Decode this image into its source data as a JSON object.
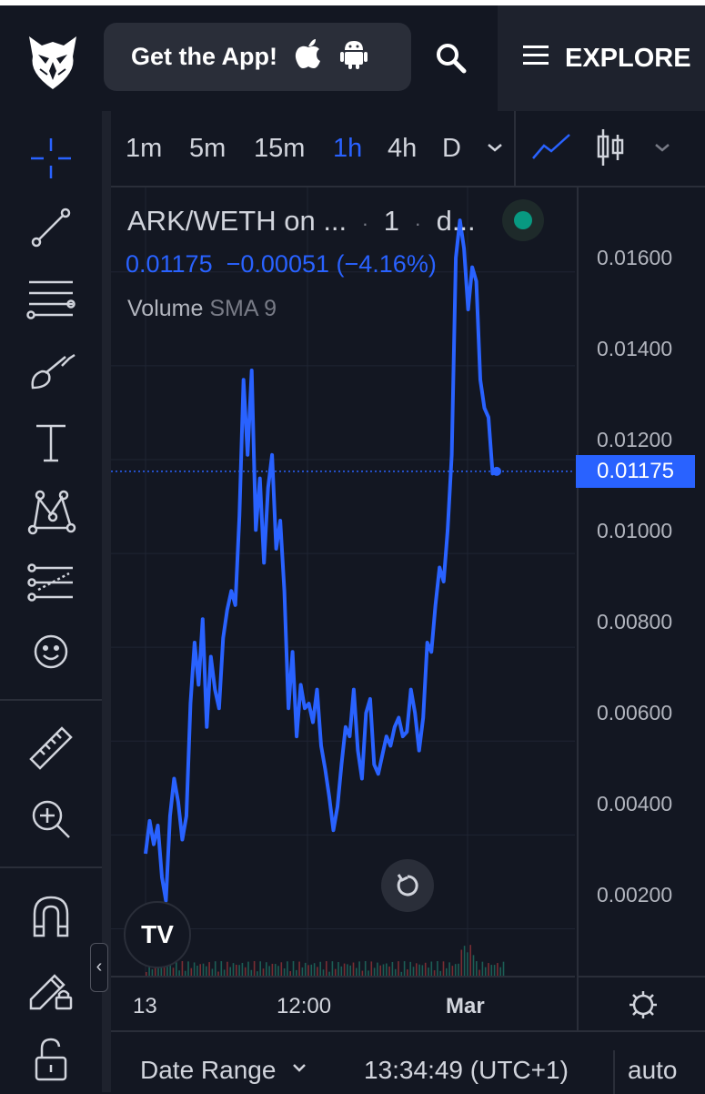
{
  "header": {
    "get_app_label": "Get the App!",
    "explore_label": "EXPLORE"
  },
  "intervals": {
    "items": [
      "1m",
      "5m",
      "15m",
      "1h",
      "4h",
      "D"
    ],
    "active": "1h"
  },
  "legend": {
    "symbol": "ARK/WETH on ...",
    "interval": "1",
    "exchange": "d...",
    "last": "0.01175",
    "change": "−0.00051",
    "change_pct": "(−4.16%)",
    "volume_label": "Volume",
    "sma_label": "SMA 9"
  },
  "chart_data": {
    "type": "line",
    "ylim": [
      0.001,
      0.0178
    ],
    "y_ticks": [
      "0.01600",
      "0.01400",
      "0.01200",
      "0.01000",
      "0.00800",
      "0.00600",
      "0.00400",
      "0.00200"
    ],
    "current_price_label": "0.01175",
    "current_price": 0.01175,
    "x_ticks": [
      "13",
      "12:00",
      "Mar"
    ],
    "line_color": "#2962ff",
    "series": [
      {
        "values": [
          0.0036,
          0.0043,
          0.0038,
          0.0042,
          0.0031,
          0.0026,
          0.0044,
          0.0052,
          0.0047,
          0.0039,
          0.0044,
          0.0068,
          0.0081,
          0.0072,
          0.0086,
          0.0063,
          0.0078,
          0.0071,
          0.0067,
          0.0082,
          0.0088,
          0.0092,
          0.0089,
          0.0108,
          0.0137,
          0.0121,
          0.0139,
          0.0105,
          0.0116,
          0.0098,
          0.0114,
          0.0121,
          0.0101,
          0.0107,
          0.0092,
          0.0067,
          0.0079,
          0.0061,
          0.0072,
          0.0067,
          0.0068,
          0.0064,
          0.0071,
          0.0059,
          0.0054,
          0.0048,
          0.0041,
          0.0046,
          0.0055,
          0.0063,
          0.0061,
          0.0071,
          0.0058,
          0.0052,
          0.0066,
          0.0069,
          0.0055,
          0.0053,
          0.0057,
          0.0061,
          0.0059,
          0.0063,
          0.0065,
          0.0061,
          0.0062,
          0.0071,
          0.0066,
          0.0058,
          0.0065,
          0.0081,
          0.0079,
          0.0089,
          0.0097,
          0.0094,
          0.0105,
          0.0121,
          0.0163,
          0.0171,
          0.0165,
          0.0152,
          0.0161,
          0.0158,
          0.0137,
          0.0131,
          0.0129,
          0.0117,
          0.01175
        ]
      }
    ]
  }
}
